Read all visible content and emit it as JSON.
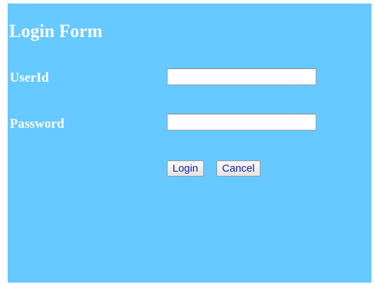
{
  "form": {
    "title": "Login Form",
    "userid_label": "UserId",
    "userid_value": "",
    "password_label": "Password",
    "password_value": "",
    "login_label": "Login",
    "cancel_label": "Cancel"
  },
  "colors": {
    "panel_background": "#66c9ff",
    "text": "#ffffff",
    "button_text": "#1a1aa8"
  }
}
